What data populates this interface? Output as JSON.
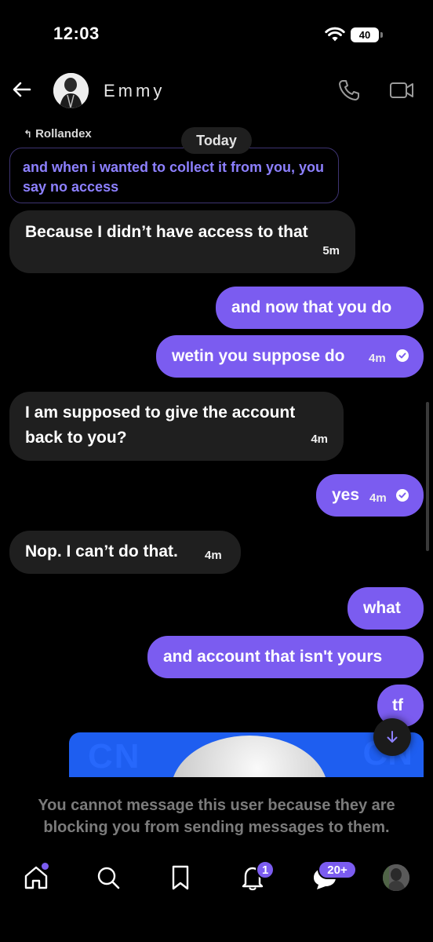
{
  "status_bar": {
    "time": "12:03",
    "battery": "40"
  },
  "header": {
    "contact_name": "Emmy"
  },
  "chat": {
    "reply_to": "Rollandex",
    "day_separator": "Today",
    "quoted_text": "and when i wanted to collect it from you, you say no access",
    "messages": [
      {
        "id": "m1",
        "direction": "in",
        "text": "Because I didn’t have access to that",
        "time": "5m"
      },
      {
        "id": "m2",
        "direction": "out",
        "text": "and now that you do",
        "time": ""
      },
      {
        "id": "m3",
        "direction": "out",
        "text": "wetin you suppose do",
        "time": "4m",
        "seen": true
      },
      {
        "id": "m4",
        "direction": "in",
        "text": "I am supposed to give the account back to you?",
        "time": "4m"
      },
      {
        "id": "m5",
        "direction": "out",
        "text": "yes",
        "time": "4m",
        "seen": true
      },
      {
        "id": "m6",
        "direction": "in",
        "text": "Nop. I can’t do that.",
        "time": "4m"
      },
      {
        "id": "m7",
        "direction": "out",
        "text": "what",
        "time": ""
      },
      {
        "id": "m8",
        "direction": "out",
        "text": "and account that isn't yours",
        "time": ""
      },
      {
        "id": "m9",
        "direction": "out",
        "text": "tf",
        "time": ""
      }
    ]
  },
  "blocked_notice": "You cannot message this user because they are blocking you from sending messages to them.",
  "bottom_nav": {
    "notifications_badge": "1",
    "messages_badge": "20+"
  },
  "colors": {
    "accent": "#7b5cf0",
    "incoming_bubble": "#1f1f1f",
    "background": "#000000",
    "quote_text": "#8d80ff"
  },
  "icons": [
    "back-arrow-icon",
    "phone-icon",
    "video-icon",
    "home-icon",
    "search-icon",
    "bookmark-icon",
    "bell-icon",
    "chat-bubble-icon",
    "arrow-down-icon",
    "check-circle-icon",
    "reply-icon",
    "wifi-icon"
  ]
}
